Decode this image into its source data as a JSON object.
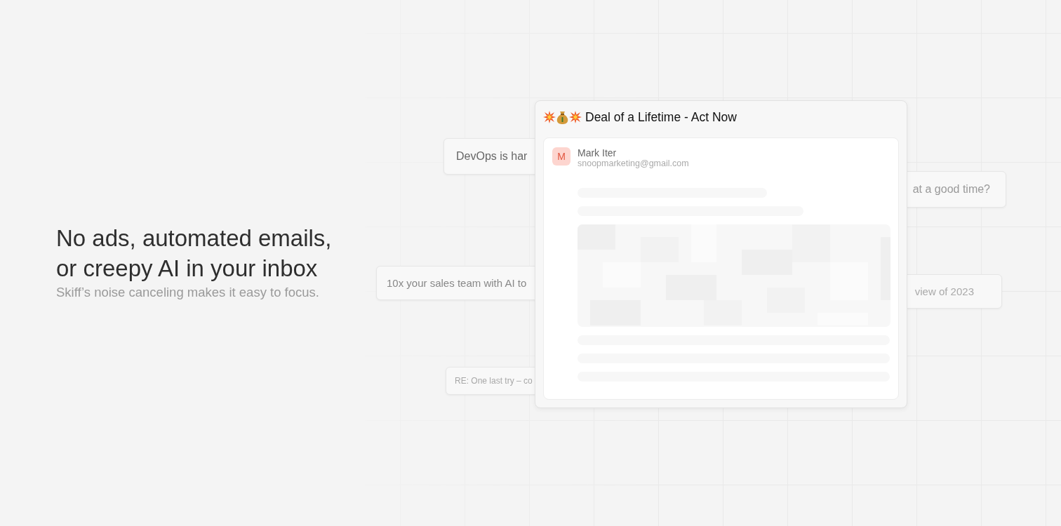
{
  "headline": [
    "No ads, automated emails,",
    "or creepy AI in your inbox"
  ],
  "subtitle": "Skiff’s noise canceling makes it easy to focus.",
  "background_cards": [
    {
      "text": "DevOps is har"
    },
    {
      "text": "at a good time?"
    },
    {
      "text": "10x your sales team with AI to"
    },
    {
      "text": "view of 2023"
    },
    {
      "text": "RE: One last try – co"
    }
  ],
  "email": {
    "title": "Deal of a Lifetime - Act Now",
    "sender": {
      "initial": "M",
      "name": "Mark Iter",
      "email": "snoopmarketing@gmail.com"
    }
  }
}
